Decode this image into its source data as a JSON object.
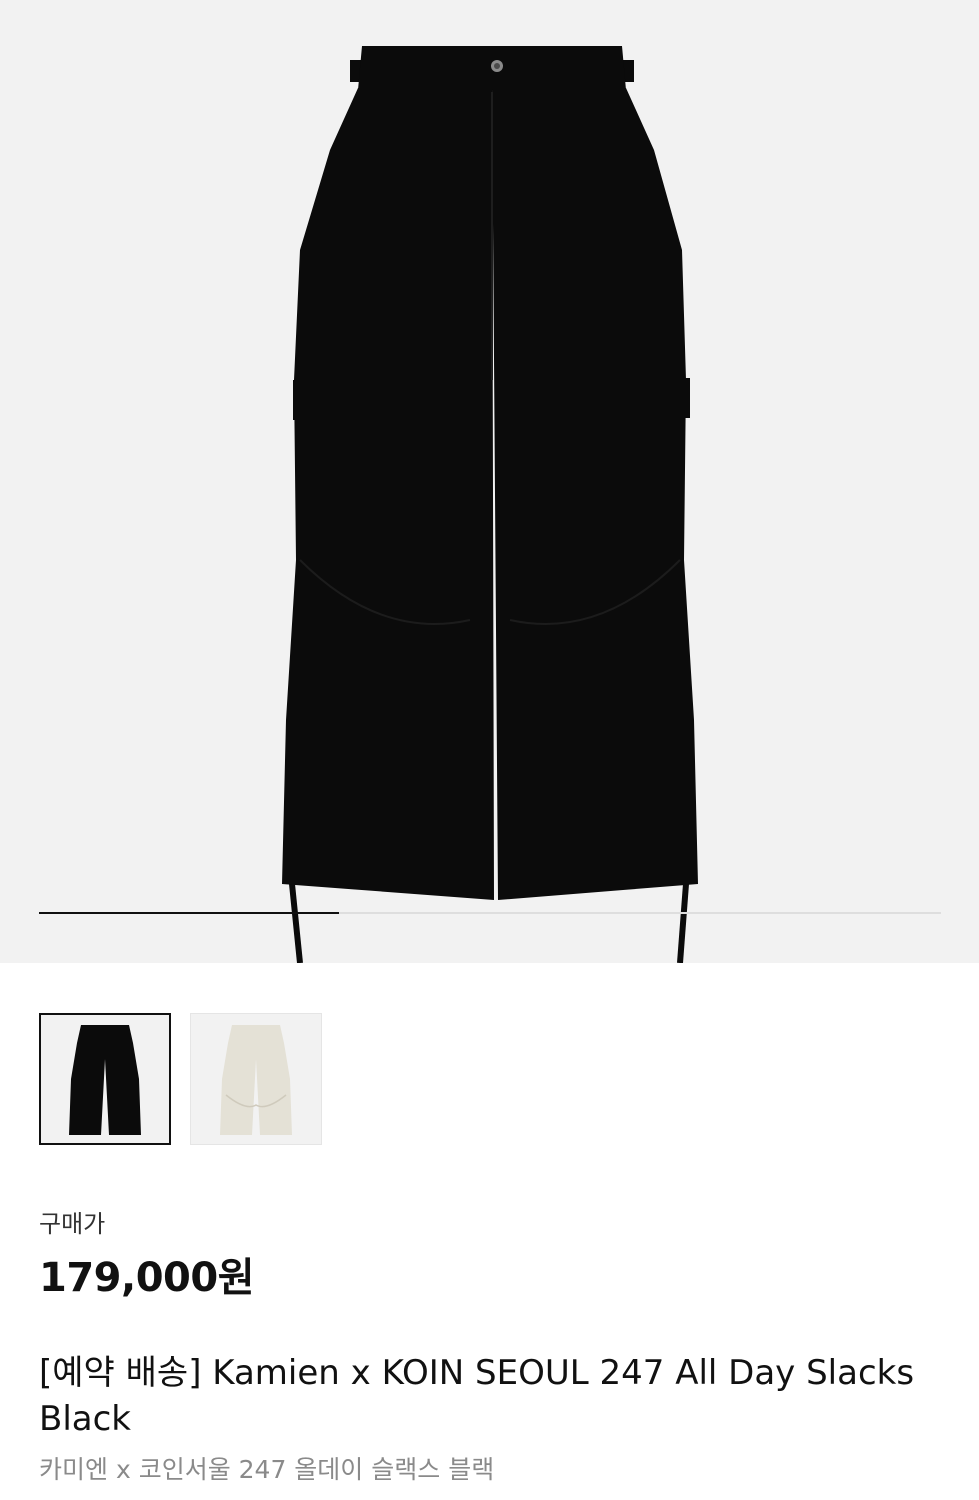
{
  "product": {
    "main_image": "black-cargo-pants",
    "gallery_progress": 0.333,
    "thumbnails": [
      {
        "image": "black-cargo-pants",
        "color": "#0b0b0b",
        "selected": true
      },
      {
        "image": "ivory-cargo-pants",
        "color": "#e4e1d6",
        "selected": false
      }
    ],
    "price_label": "구매가",
    "price": "179,000원",
    "title": "[예약 배송] Kamien x KOIN SEOUL 247 All Day Slacks Black",
    "subtitle": "카미엔 x 코인서울 247 올데이 슬랙스 블랙"
  },
  "colors": {
    "hero_bg": "#f2f2f2",
    "pants_black": "#0b0b0b",
    "pants_ivory": "#e4e1d6",
    "accent_text": "#111111",
    "muted_text": "#8a8a8a"
  }
}
